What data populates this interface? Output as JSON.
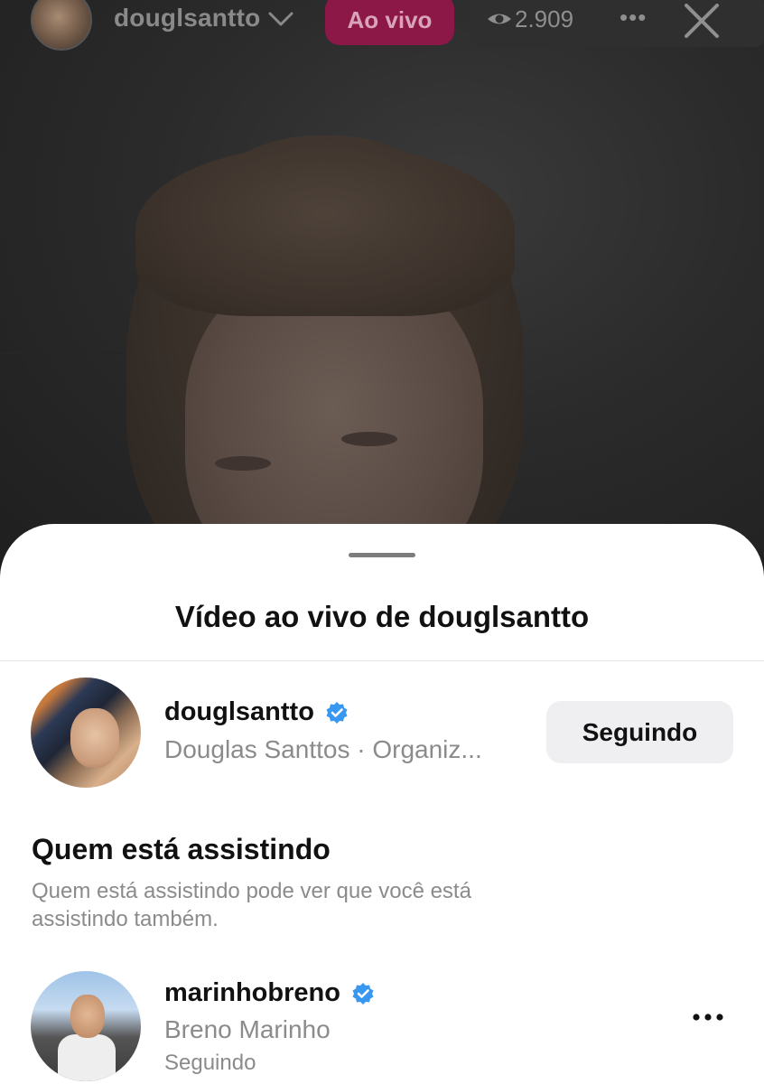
{
  "live_header": {
    "username": "douglsantto",
    "live_label": "Ao vivo",
    "viewer_count": "2.909"
  },
  "sheet": {
    "title": "Vídeo ao vivo de douglsantto",
    "host": {
      "username": "douglsantto",
      "subtitle": "Douglas Santtos · Organiz...",
      "verified": true,
      "follow_label": "Seguindo"
    },
    "viewers_section": {
      "title": "Quem está assistindo",
      "description": "Quem está assistindo pode ver que você está assistindo também."
    },
    "viewers": [
      {
        "username": "marinhobreno",
        "full_name": "Breno Marinho",
        "status": "Seguindo",
        "verified": true
      }
    ]
  },
  "colors": {
    "live_badge": "#8c1848",
    "verified": "#3897f0"
  },
  "icons": [
    "chevron-down-icon",
    "eye-icon",
    "more-icon",
    "close-icon",
    "verified-icon"
  ]
}
